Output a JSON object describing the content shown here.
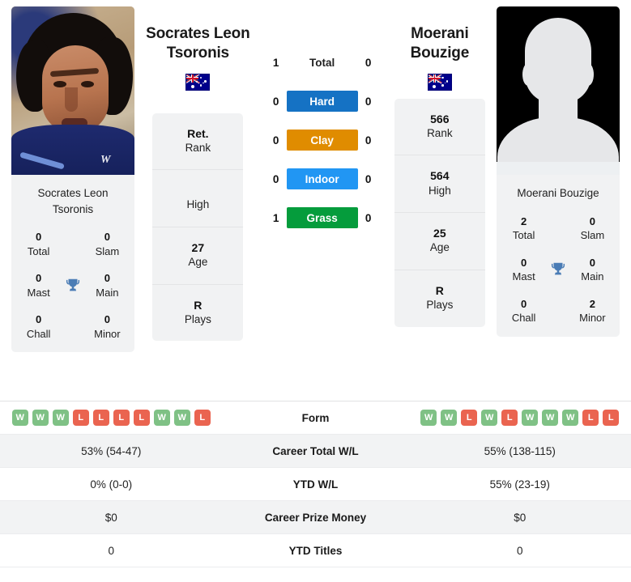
{
  "players": {
    "left": {
      "name": "Socrates Leon Tsoronis",
      "name_line1": "Socrates Leon",
      "name_line2": "Tsoronis",
      "card_name": "Socrates Leon Tsoronis",
      "flag": "australia-flag",
      "photo": "player-photo",
      "titles": [
        {
          "value": "0",
          "label": "Total"
        },
        {
          "value": "0",
          "label": "Slam"
        },
        {
          "value": "0",
          "label": "Mast"
        },
        {
          "value": "0",
          "label": "Main"
        },
        {
          "value": "0",
          "label": "Chall"
        },
        {
          "value": "0",
          "label": "Minor"
        }
      ],
      "info": [
        {
          "value": "Ret.",
          "label": "Rank"
        },
        {
          "value": "",
          "label": "High"
        },
        {
          "value": "27",
          "label": "Age"
        },
        {
          "value": "R",
          "label": "Plays"
        }
      ],
      "surfaces": {
        "total": "1",
        "hard": "0",
        "clay": "0",
        "indoor": "0",
        "grass": "1"
      },
      "form": [
        "W",
        "W",
        "W",
        "L",
        "L",
        "L",
        "L",
        "W",
        "W",
        "L"
      ],
      "career_total_wl": "53% (54-47)",
      "ytd_wl": "0% (0-0)",
      "career_prize_money": "$0",
      "ytd_titles": "0"
    },
    "right": {
      "name": "Moerani Bouzige",
      "name_line1": "Moerani",
      "name_line2": "Bouzige",
      "card_name": "Moerani Bouzige",
      "flag": "australia-flag",
      "photo": "player-photo-placeholder",
      "titles": [
        {
          "value": "2",
          "label": "Total"
        },
        {
          "value": "0",
          "label": "Slam"
        },
        {
          "value": "0",
          "label": "Mast"
        },
        {
          "value": "0",
          "label": "Main"
        },
        {
          "value": "0",
          "label": "Chall"
        },
        {
          "value": "2",
          "label": "Minor"
        }
      ],
      "info": [
        {
          "value": "566",
          "label": "Rank"
        },
        {
          "value": "564",
          "label": "High"
        },
        {
          "value": "25",
          "label": "Age"
        },
        {
          "value": "R",
          "label": "Plays"
        }
      ],
      "surfaces": {
        "total": "0",
        "hard": "0",
        "clay": "0",
        "indoor": "0",
        "grass": "0"
      },
      "form": [
        "W",
        "W",
        "L",
        "W",
        "L",
        "W",
        "W",
        "W",
        "L",
        "L"
      ],
      "career_total_wl": "55% (138-115)",
      "ytd_wl": "55% (23-19)",
      "career_prize_money": "$0",
      "ytd_titles": "0"
    }
  },
  "surfaces": [
    {
      "key": "total",
      "label": "Total",
      "color": ""
    },
    {
      "key": "hard",
      "label": "Hard",
      "color": "#1572c4"
    },
    {
      "key": "clay",
      "label": "Clay",
      "color": "#e08c00"
    },
    {
      "key": "indoor",
      "label": "Indoor",
      "color": "#2196f3"
    },
    {
      "key": "grass",
      "label": "Grass",
      "color": "#059c3c"
    }
  ],
  "table_labels": {
    "form": "Form",
    "career_total_wl": "Career Total W/L",
    "ytd_wl": "YTD W/L",
    "career_prize_money": "Career Prize Money",
    "ytd_titles": "YTD Titles"
  },
  "colors": {
    "hard": "#1572c4",
    "clay": "#e08c00",
    "indoor": "#2196f3",
    "grass": "#059c3c",
    "win_badge": "#7fc185",
    "loss_badge": "#ea6450",
    "trophy": "#4a7cb5",
    "panel_bg": "#f1f2f3"
  }
}
